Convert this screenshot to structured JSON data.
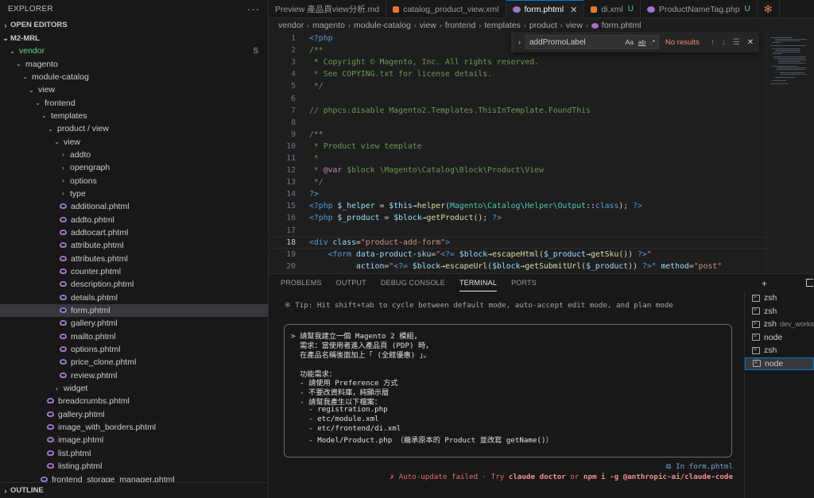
{
  "sidebar": {
    "title": "EXPLORER",
    "more": "···",
    "open_editors": "OPEN EDITORS",
    "workspace": "M2-MRL",
    "outline": "OUTLINE",
    "tree": [
      {
        "label": "vendor",
        "depth": 0,
        "kind": "folder",
        "git": true,
        "badge": "S"
      },
      {
        "label": "magento",
        "depth": 1,
        "kind": "folder"
      },
      {
        "label": "module-catalog",
        "depth": 2,
        "kind": "folder"
      },
      {
        "label": "view",
        "depth": 3,
        "kind": "folder"
      },
      {
        "label": "frontend",
        "depth": 4,
        "kind": "folder"
      },
      {
        "label": "templates",
        "depth": 5,
        "kind": "folder"
      },
      {
        "label": "product / view",
        "depth": 6,
        "kind": "folder"
      },
      {
        "label": "view",
        "depth": 7,
        "kind": "folder"
      },
      {
        "label": "addto",
        "depth": 8,
        "kind": "folder-closed"
      },
      {
        "label": "opengraph",
        "depth": 8,
        "kind": "folder-closed"
      },
      {
        "label": "options",
        "depth": 8,
        "kind": "folder-closed"
      },
      {
        "label": "type",
        "depth": 8,
        "kind": "folder-closed"
      },
      {
        "label": "additional.phtml",
        "depth": 8,
        "kind": "file"
      },
      {
        "label": "addto.phtml",
        "depth": 8,
        "kind": "file"
      },
      {
        "label": "addtocart.phtml",
        "depth": 8,
        "kind": "file"
      },
      {
        "label": "attribute.phtml",
        "depth": 8,
        "kind": "file"
      },
      {
        "label": "attributes.phtml",
        "depth": 8,
        "kind": "file"
      },
      {
        "label": "counter.phtml",
        "depth": 8,
        "kind": "file"
      },
      {
        "label": "description.phtml",
        "depth": 8,
        "kind": "file"
      },
      {
        "label": "details.phtml",
        "depth": 8,
        "kind": "file"
      },
      {
        "label": "form.phtml",
        "depth": 8,
        "kind": "file",
        "selected": true
      },
      {
        "label": "gallery.phtml",
        "depth": 8,
        "kind": "file"
      },
      {
        "label": "mailto.phtml",
        "depth": 8,
        "kind": "file"
      },
      {
        "label": "options.phtml",
        "depth": 8,
        "kind": "file"
      },
      {
        "label": "price_clone.phtml",
        "depth": 8,
        "kind": "file"
      },
      {
        "label": "review.phtml",
        "depth": 8,
        "kind": "file"
      },
      {
        "label": "widget",
        "depth": 7,
        "kind": "folder-closed"
      },
      {
        "label": "breadcrumbs.phtml",
        "depth": 6,
        "kind": "file"
      },
      {
        "label": "gallery.phtml",
        "depth": 6,
        "kind": "file"
      },
      {
        "label": "image_with_borders.phtml",
        "depth": 6,
        "kind": "file"
      },
      {
        "label": "image.phtml",
        "depth": 6,
        "kind": "file"
      },
      {
        "label": "list.phtml",
        "depth": 6,
        "kind": "file"
      },
      {
        "label": "listing.phtml",
        "depth": 6,
        "kind": "file"
      },
      {
        "label": "frontend_storage_manager.phtml",
        "depth": 5,
        "kind": "file"
      }
    ]
  },
  "tabs": [
    {
      "label": "Preview 產品頁view分析.md",
      "icon": "preview-icon",
      "active": false
    },
    {
      "label": "catalog_product_view.xml",
      "icon": "xml-icon",
      "active": false
    },
    {
      "label": "form.phtml",
      "icon": "php-icon",
      "active": true,
      "close": "✕"
    },
    {
      "label": "di.xml",
      "icon": "xml-icon",
      "active": false,
      "status": "U"
    },
    {
      "label": "ProductNameTag.php",
      "icon": "php-icon",
      "active": false,
      "status": "U"
    }
  ],
  "breadcrumbs": [
    "vendor",
    "magento",
    "module-catalog",
    "view",
    "frontend",
    "templates",
    "product",
    "view",
    "form.phtml"
  ],
  "find": {
    "query": "addPromoLabel",
    "options": [
      "Aa",
      "ab",
      ".*"
    ],
    "result": "No results"
  },
  "code_lines": [
    {
      "n": "1",
      "html": "<span class='t-tag'>&lt;?php</span>"
    },
    {
      "n": "2",
      "html": "<span class='t-cmt'>/**</span>"
    },
    {
      "n": "3",
      "html": "<span class='t-cmt'> * Copyright © Magento, Inc. All rights reserved.</span>"
    },
    {
      "n": "4",
      "html": "<span class='t-cmt'> * See COPYING.txt for license details.</span>"
    },
    {
      "n": "5",
      "html": "<span class='t-cmt'> */</span>"
    },
    {
      "n": "6",
      "html": ""
    },
    {
      "n": "7",
      "html": "<span class='t-cmt'>// phpcs:disable Magento2.Templates.ThisInTemplate.FoundThis</span>"
    },
    {
      "n": "8",
      "html": ""
    },
    {
      "n": "9",
      "html": "<span class='t-cmt'>/**</span>"
    },
    {
      "n": "10",
      "html": "<span class='t-cmt'> * Product view template</span>"
    },
    {
      "n": "11",
      "html": "<span class='t-cmt'> *</span>"
    },
    {
      "n": "12",
      "html": "<span class='t-cmt'> * </span><span class='t-kw'>@var</span><span class='t-cmt'> $block \\Magento\\Catalog\\Block\\Product\\View</span>"
    },
    {
      "n": "13",
      "html": "<span class='t-cmt'> */</span>"
    },
    {
      "n": "14",
      "html": "<span class='t-tag'>?&gt;</span>"
    },
    {
      "n": "15",
      "html": "<span class='t-tag'>&lt;?php</span> <span class='t-var'>$_helper</span> = <span class='t-var'>$this</span>→<span class='t-fn'>helper</span>(<span class='t-cls'>Magento\\Catalog\\Helper\\Output</span>::<span class='t-tag'>class</span>); <span class='t-tag'>?&gt;</span>"
    },
    {
      "n": "16",
      "html": "<span class='t-tag'>&lt;?php</span> <span class='t-var'>$_product</span> = <span class='t-var'>$block</span>→<span class='t-fn'>getProduct</span>(); <span class='t-tag'>?&gt;</span>"
    },
    {
      "n": "17",
      "html": ""
    },
    {
      "n": "18",
      "html": "<span class='t-tag'>&lt;div</span> <span class='t-attr'>class</span>=<span class='t-str'>\"product-add-form\"</span><span class='t-tag'>&gt;</span>",
      "cur": true
    },
    {
      "n": "19",
      "html": "    <span class='t-tag'>&lt;form</span> <span class='t-attr'>data-product-sku</span>=<span class='t-str'>\"</span><span class='t-tag'>&lt;?=</span> <span class='t-var'>$block</span>→<span class='t-fn'>escapeHtml</span>(<span class='t-var'>$_product</span>→<span class='t-fn'>getSku</span>()) <span class='t-tag'>?&gt;</span><span class='t-str'>\"</span>"
    },
    {
      "n": "20",
      "html": "          <span class='t-attr'>action</span>=<span class='t-str'>\"</span><span class='t-tag'>&lt;?=</span> <span class='t-var'>$block</span>→<span class='t-fn'>escapeUrl</span>(<span class='t-var'>$block</span>→<span class='t-fn'>getSubmitUrl</span>(<span class='t-var'>$_product</span>)) <span class='t-tag'>?&gt;</span><span class='t-str'>\"</span> <span class='t-attr'>method</span>=<span class='t-str'>\"post\"</span>"
    },
    {
      "n": "21",
      "html": "          <span class='t-attr'>id</span>=<span class='t-str'>\"product_addtocart_form\"</span><span class='t-tag'>&lt;?php</span> <span class='t-kw'>if</span> (<span class='t-var'>$_product</span>→<span class='t-fn'>getOptions</span>()) :<span class='t-tag'>?&gt;</span> <span class='t-attr'>enctype</span>=<span class='t-str'>\"multipart/form</span>"
    }
  ],
  "panel": {
    "tabs": [
      "PROBLEMS",
      "OUTPUT",
      "DEBUG CONSOLE",
      "TERMINAL",
      "PORTS"
    ],
    "active_tab": "TERMINAL",
    "add": "+",
    "tip": "※ Tip: Hit shift+tab to cycle between default mode, auto-accept edit mode, and plan mode",
    "prompt_lines": [
      "> 請幫我建立一個 Magento 2 模組，",
      "  需求：當使用者進入產品頁 (PDP) 時，",
      "  在產品名稱後面加上「 (全館優惠) 」。",
      "",
      "  功能需求：",
      "  - 請使用 Preference 方式",
      "  - 不要改資料庫，純顯示層",
      "  - 請幫我產生以下檔案：",
      "    - registration.php",
      "    - etc/module.xml",
      "    - etc/frontend/di.xml",
      "    - Model/Product.php （繼承原本的 Product 並改寫 getName()）"
    ],
    "in_file": "⧉ In form.phtml",
    "auto_update_prefix": "✗ Auto-update failed · Try ",
    "auto_update_cmd1": "claude doctor",
    "auto_update_or": " or ",
    "auto_update_cmd2": "npm i -g @anthropic-ai/claude-code",
    "terminals": [
      {
        "label": "zsh",
        "sub": ""
      },
      {
        "label": "zsh",
        "sub": ""
      },
      {
        "label": "zsh",
        "sub": "dev_works"
      },
      {
        "label": "node",
        "sub": ""
      },
      {
        "label": "zsh",
        "sub": ""
      },
      {
        "label": "node",
        "sub": "",
        "active": true
      }
    ]
  }
}
